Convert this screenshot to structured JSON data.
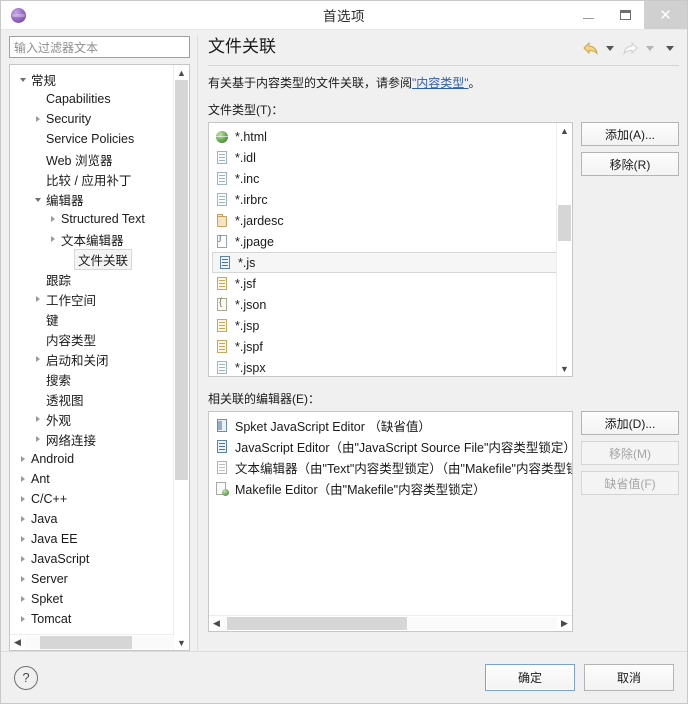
{
  "window": {
    "title": "首选项",
    "app_icon": "purple-sphere-icon",
    "controls": {
      "minimize": "minimize-icon",
      "maximize": "maximize-icon",
      "close": "✕"
    }
  },
  "sidebar": {
    "filter": {
      "placeholder": "输入过滤器文本",
      "value": ""
    },
    "tree": [
      {
        "label": "常规",
        "indent": 0,
        "twisty": "expanded"
      },
      {
        "label": "Capabilities",
        "indent": 1,
        "twisty": "none"
      },
      {
        "label": "Security",
        "indent": 1,
        "twisty": "collapsed"
      },
      {
        "label": "Service Policies",
        "indent": 1,
        "twisty": "none"
      },
      {
        "label": "Web 浏览器",
        "indent": 1,
        "twisty": "none"
      },
      {
        "label": "比较 / 应用补丁",
        "indent": 1,
        "twisty": "none"
      },
      {
        "label": "编辑器",
        "indent": 1,
        "twisty": "expanded"
      },
      {
        "label": "Structured Text",
        "indent": 2,
        "twisty": "collapsed"
      },
      {
        "label": "文本编辑器",
        "indent": 2,
        "twisty": "collapsed"
      },
      {
        "label": "文件关联",
        "indent": 3,
        "twisty": "none",
        "selected": true
      },
      {
        "label": "跟踪",
        "indent": 1,
        "twisty": "none"
      },
      {
        "label": "工作空间",
        "indent": 1,
        "twisty": "collapsed"
      },
      {
        "label": "键",
        "indent": 1,
        "twisty": "none"
      },
      {
        "label": "内容类型",
        "indent": 1,
        "twisty": "none"
      },
      {
        "label": "启动和关闭",
        "indent": 1,
        "twisty": "collapsed"
      },
      {
        "label": "搜索",
        "indent": 1,
        "twisty": "none"
      },
      {
        "label": "透视图",
        "indent": 1,
        "twisty": "none"
      },
      {
        "label": "外观",
        "indent": 1,
        "twisty": "collapsed"
      },
      {
        "label": "网络连接",
        "indent": 1,
        "twisty": "collapsed"
      },
      {
        "label": "Android",
        "indent": 0,
        "twisty": "collapsed"
      },
      {
        "label": "Ant",
        "indent": 0,
        "twisty": "collapsed"
      },
      {
        "label": "C/C++",
        "indent": 0,
        "twisty": "collapsed"
      },
      {
        "label": "Java",
        "indent": 0,
        "twisty": "collapsed"
      },
      {
        "label": "Java EE",
        "indent": 0,
        "twisty": "collapsed"
      },
      {
        "label": "JavaScript",
        "indent": 0,
        "twisty": "collapsed"
      },
      {
        "label": "Server",
        "indent": 0,
        "twisty": "collapsed"
      },
      {
        "label": "Spket",
        "indent": 0,
        "twisty": "collapsed"
      },
      {
        "label": "Tomcat",
        "indent": 0,
        "twisty": "collapsed"
      }
    ]
  },
  "page": {
    "title": "文件关联",
    "nav": {
      "back": "back-arrow-icon",
      "forward": "forward-arrow-icon",
      "menu": "dropdown-chevron-icon"
    },
    "description_prefix": "有关基于内容类型的文件关联，请参阅",
    "description_link": "\"内容类型\"",
    "description_suffix": "。",
    "file_types_label": "文件类型(T)：",
    "file_types": [
      {
        "name": "*.html",
        "icon": "globe"
      },
      {
        "name": "*.idl",
        "icon": "doc"
      },
      {
        "name": "*.inc",
        "icon": "doc"
      },
      {
        "name": "*.irbrc",
        "icon": "doc"
      },
      {
        "name": "*.jardesc",
        "icon": "jar"
      },
      {
        "name": "*.jpage",
        "icon": "jfile"
      },
      {
        "name": "*.js",
        "icon": "js",
        "selected": true
      },
      {
        "name": "*.jsf",
        "icon": "jsf"
      },
      {
        "name": "*.json",
        "icon": "json"
      },
      {
        "name": "*.jsp",
        "icon": "jsf"
      },
      {
        "name": "*.jspf",
        "icon": "jsf"
      },
      {
        "name": "*.jspx",
        "icon": "doc"
      }
    ],
    "file_type_buttons": [
      {
        "label": "添加(A)...",
        "enabled": true
      },
      {
        "label": "移除(R)",
        "enabled": true
      }
    ],
    "editors_label": "相关联的编辑器(E)：",
    "editors": [
      {
        "name": "Spket JavaScript Editor （缺省值）",
        "icon": "jsedit"
      },
      {
        "name": "JavaScript Editor（由\"JavaScript Source File\"内容类型锁定）",
        "icon": "js"
      },
      {
        "name": "文本编辑器（由\"Text\"内容类型锁定）（由\"Makefile\"内容类型锁定",
        "icon": "text"
      },
      {
        "name": "Makefile Editor（由\"Makefile\"内容类型锁定）",
        "icon": "make"
      }
    ],
    "editor_buttons": [
      {
        "label": "添加(D)...",
        "enabled": true
      },
      {
        "label": "移除(M)",
        "enabled": false
      },
      {
        "label": "缺省值(F)",
        "enabled": false
      }
    ]
  },
  "footer": {
    "help": "?",
    "ok": "确定",
    "cancel": "取消"
  },
  "colors": {
    "link": "#2f5fb5",
    "default_button_border": "#7aa3d4",
    "close_button": "#d0d0d0",
    "scroll_thumb": "#d6d6d6"
  }
}
